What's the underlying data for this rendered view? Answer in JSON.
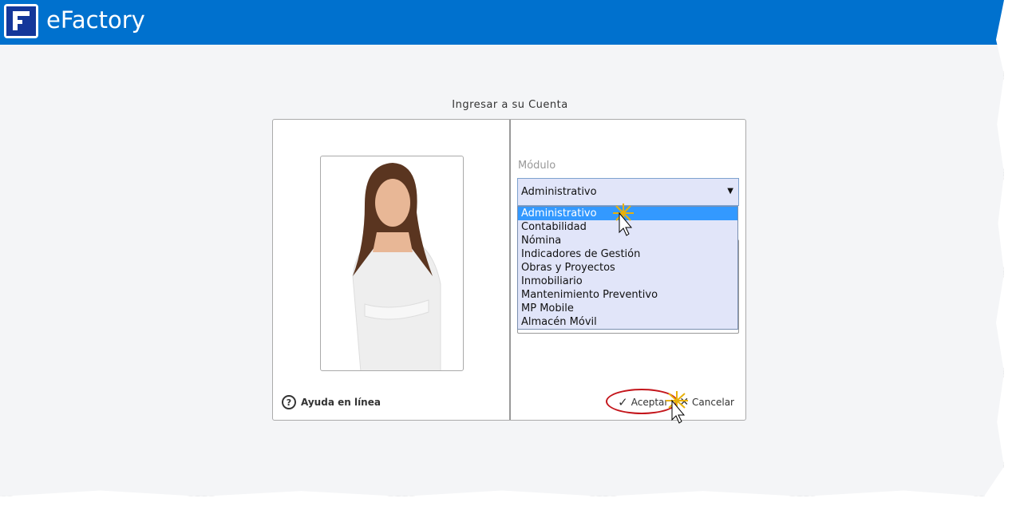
{
  "header": {
    "app_title": "eFactory"
  },
  "login": {
    "title": "Ingresar a su Cuenta"
  },
  "help": {
    "label": "Ayuda en línea",
    "icon": "?"
  },
  "module": {
    "label": "Módulo",
    "selected": "Administrativo",
    "options": [
      "Administrativo",
      "Contabilidad",
      "Nómina",
      "Indicadores de Gestión",
      "Obras y Proyectos",
      "Inmobiliario",
      "Mantenimiento Preventivo",
      "MP Mobile",
      "Almacén Móvil"
    ]
  },
  "actions": {
    "accept": "Aceptar",
    "cancel": "Cancelar"
  },
  "colors": {
    "header": "#0071ce",
    "highlight": "#3399ff",
    "select_bg": "#e1e5f9",
    "annotation": "#c4161c"
  }
}
